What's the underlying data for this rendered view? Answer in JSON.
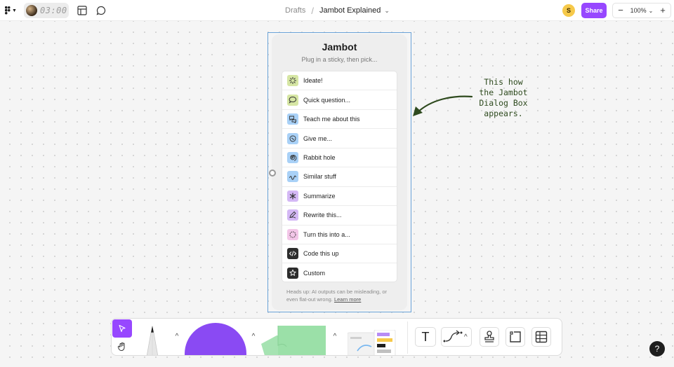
{
  "topbar": {
    "timer": "03:00",
    "breadcrumb_parent": "Drafts",
    "breadcrumb_sep": "/",
    "file_name": "Jambot Explained",
    "user_initial": "S",
    "share_label": "Share",
    "zoom_out": "−",
    "zoom_level": "100%",
    "zoom_in": "+"
  },
  "dialog": {
    "title": "Jambot",
    "subtitle": "Plug in a sticky, then pick...",
    "items": [
      {
        "label": "Ideate!",
        "icon": "sparkle-icon",
        "color": "#d6e6a4"
      },
      {
        "label": "Quick question...",
        "icon": "speech-bubble-icon",
        "color": "#d6e6a4"
      },
      {
        "label": "Teach me about this",
        "icon": "chat-bubbles-icon",
        "color": "#a9d1f7"
      },
      {
        "label": "Give me...",
        "icon": "brain-icon",
        "color": "#a9d1f7"
      },
      {
        "label": "Rabbit hole",
        "icon": "spiral-icon",
        "color": "#a9d1f7"
      },
      {
        "label": "Similar stuff",
        "icon": "squiggle-icon",
        "color": "#a9d1f7"
      },
      {
        "label": "Summarize",
        "icon": "asterisk-icon",
        "color": "#d4b8f5"
      },
      {
        "label": "Rewrite this...",
        "icon": "rewrite-icon",
        "color": "#d4b8f5"
      },
      {
        "label": "Turn this into a...",
        "icon": "transform-icon",
        "color": "#f3c6e8"
      },
      {
        "label": "Code this up",
        "icon": "code-icon",
        "color": "#2c2c2c"
      },
      {
        "label": "Custom",
        "icon": "custom-icon",
        "color": "#2c2c2c"
      }
    ],
    "footer_text": "Heads up: AI outputs can be misleading, or even flat-out wrong.",
    "footer_link": "Learn more"
  },
  "annotation": {
    "lines": [
      "This how",
      "the Jambot",
      "Dialog Box",
      "appears."
    ]
  },
  "colors": {
    "accent": "#9747ff",
    "annotation": "#2e4a1e",
    "selection": "#6aa3d8"
  },
  "toolbar": {
    "text_tool_label": "T",
    "help_label": "?"
  }
}
